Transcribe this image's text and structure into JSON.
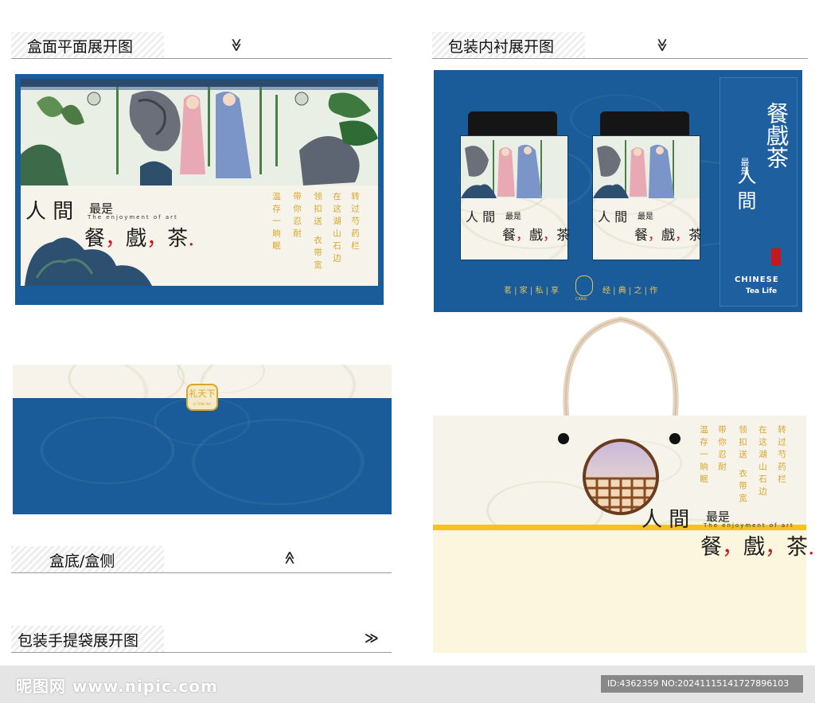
{
  "sections": {
    "box_plane": {
      "title": "盒面平面展开图",
      "chevron": "≫"
    },
    "inner_liner": {
      "title": "包装内衬展开图",
      "chevron": "≫"
    },
    "box_bottom": {
      "title": "盒底/盒侧",
      "chevron": "≫"
    },
    "handbag": {
      "title": "包装手提袋展开图",
      "chevron": "≫"
    }
  },
  "slogan": {
    "line1": "人 間",
    "emph": "最是",
    "english": "The enjoyment of art",
    "line2": "餐",
    "line2b": "戲",
    "line2c": "茶",
    "comma": "，"
  },
  "poem": [
    "转过芍药栏",
    "在这湖山石边",
    "领扣送 衣带宽",
    "带你忍耐",
    "温存一晌眠"
  ],
  "liner": {
    "side_vertical_1": "人 間",
    "side_vertical_emph": "最是",
    "side_vertical_2": "餐戲茶",
    "chinese": "CHINESE",
    "tea_life": "Tea Life",
    "bottom_left": "茗 | 家 | 私 | 享",
    "bottom_right": "经 | 典 | 之 | 作",
    "logo_sub": "CANG"
  },
  "box_bottom": {
    "logo": "礼天下",
    "logo_sub": "LI TIAN XIA"
  },
  "watermark": {
    "left": "昵图网 www.nipic.com",
    "right": "ID:4362359 NO:20241115141727896103"
  },
  "colors": {
    "blue": "#1a5c99",
    "paper": "#f6f3ea",
    "gold": "#d9a62a",
    "red": "#c8161d",
    "yellow_band": "#f5c31c"
  }
}
